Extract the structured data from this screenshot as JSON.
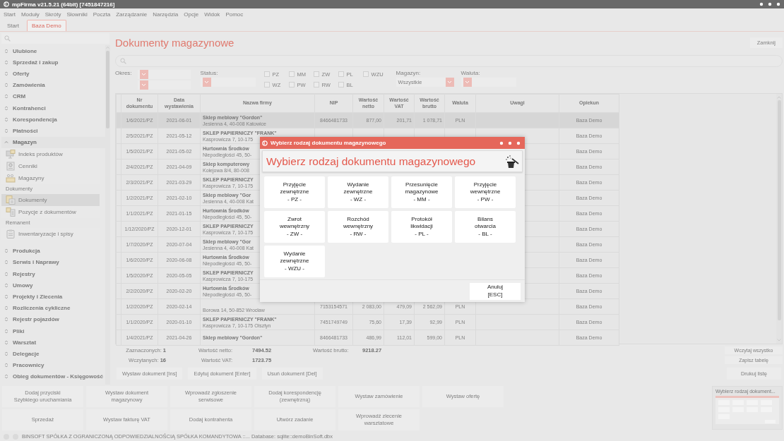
{
  "window": {
    "title": "mpFirma v21.5.21 (64bit) [7451847216]"
  },
  "menu": [
    "Start",
    "Moduły",
    "Skróty",
    "Słowniki",
    "Poczta",
    "Zarządzanie",
    "Narzędzia",
    "Opcje",
    "Widok",
    "Pomoc"
  ],
  "tabs": [
    {
      "label": "Start",
      "selected": false
    },
    {
      "label": "Baza Demo",
      "selected": true
    }
  ],
  "sidebar": {
    "sections": [
      {
        "label": "Ulubione",
        "expanded": false
      },
      {
        "label": "Sprzedaż i zakup",
        "expanded": false
      },
      {
        "label": "Oferty",
        "expanded": false
      },
      {
        "label": "Zamówienia",
        "expanded": false
      },
      {
        "label": "CRM",
        "expanded": false
      },
      {
        "label": "Kontrahenci",
        "expanded": false
      },
      {
        "label": "Korespondencja",
        "expanded": false
      },
      {
        "label": "Płatności",
        "expanded": false
      },
      {
        "label": "Magazyn",
        "expanded": true,
        "children": [
          {
            "kind": "item",
            "label": "Indeks produktów",
            "selected": false
          },
          {
            "kind": "item",
            "label": "Cenniki",
            "selected": false
          },
          {
            "kind": "item",
            "label": "Magazyny",
            "selected": false
          },
          {
            "kind": "group",
            "label": "Dokumenty"
          },
          {
            "kind": "item",
            "label": "Dokumenty",
            "selected": true
          },
          {
            "kind": "item",
            "label": "Pozycje z dokumentów",
            "selected": false
          },
          {
            "kind": "group",
            "label": "Remanent"
          },
          {
            "kind": "item",
            "label": "Inwentaryzacje i spisy",
            "selected": false
          }
        ]
      },
      {
        "label": "Produkcja",
        "expanded": false
      },
      {
        "label": "Serwis i Naprawy",
        "expanded": false
      },
      {
        "label": "Rejestry",
        "expanded": false
      },
      {
        "label": "Umowy",
        "expanded": false
      },
      {
        "label": "Projekty i Zlecenia",
        "expanded": false
      },
      {
        "label": "Rozliczenia cykliczne",
        "expanded": false
      },
      {
        "label": "Rejestr pojazdów",
        "expanded": false
      },
      {
        "label": "Pliki",
        "expanded": false
      },
      {
        "label": "Warsztat",
        "expanded": false
      },
      {
        "label": "Delegacje",
        "expanded": false
      },
      {
        "label": "Pracownicy",
        "expanded": false
      },
      {
        "label": "Obieg dokumentów - Księgowość",
        "expanded": false
      }
    ]
  },
  "page": {
    "title": "Dokumenty magazynowe",
    "close_button": "Zamknij",
    "filters": {
      "period_label": "Okres:",
      "status_label": "Status:",
      "types": [
        {
          "label": "PZ",
          "checked": false
        },
        {
          "label": "MM",
          "checked": false
        },
        {
          "label": "ZW",
          "checked": false
        },
        {
          "label": "PL",
          "checked": false
        },
        {
          "label": "WZU",
          "checked": false
        },
        {
          "label": "WZ",
          "checked": false
        },
        {
          "label": "PW",
          "checked": false
        },
        {
          "label": "RW",
          "checked": false
        },
        {
          "label": "BL",
          "checked": false
        }
      ],
      "warehouse": {
        "label": "Magazyn:",
        "value": "Wszystkie"
      },
      "currency": {
        "label": "Waluta:"
      }
    },
    "table": {
      "columns": [
        "Nr dokumentu",
        "Data wystawienia",
        "Nazwa firmy",
        "NIP",
        "Wartość netto",
        "Wartość VAT",
        "Wartość brutto",
        "Waluta",
        "Uwagi",
        "Opiekun"
      ],
      "rows": [
        {
          "selected": true,
          "number": "1/6/2021/PZ",
          "date": "2021-06-01",
          "company": "Sklep meblowy \"Gordon\"",
          "address": "Jesienna 4, 40-008 Katowice",
          "nip": "8466481733",
          "net": "877,00",
          "vat": "201,71",
          "gross": "1 078,71",
          "currency": "PLN",
          "owner": "Baza Demo"
        },
        {
          "selected": false,
          "number": "2/5/2021/PZ",
          "date": "2021-05-12",
          "company": "SKLEP PAPIERNICZY \"FRANK\"",
          "address": "Kasprowicza 7, 10-175",
          "owner": "Baza Demo"
        },
        {
          "selected": false,
          "number": "1/5/2021/PZ",
          "date": "2021-05-02",
          "company": "Hurtownia Środków",
          "address": "Niepodległości 45, 50-",
          "owner": "Baza Demo"
        },
        {
          "selected": false,
          "number": "2/4/2021/PZ",
          "date": "2021-04-09",
          "company": "Sklep komputerowy",
          "address": "Kolejowa 8/4, 80-008",
          "owner": "Baza Demo"
        },
        {
          "selected": false,
          "number": "2/3/2021/PZ",
          "date": "2021-03-29",
          "company": "SKLEP PAPIERNICZY",
          "address": "Kasprowicza 7, 10-175",
          "owner": "Baza Demo"
        },
        {
          "selected": false,
          "number": "1/2/2021/PZ",
          "date": "2021-02-10",
          "company": "Sklep meblowy \"Gor",
          "address": "Jesienna 4, 40-008 Kat",
          "owner": "Baza Demo"
        },
        {
          "selected": false,
          "number": "1/1/2021/PZ",
          "date": "2021-01-15",
          "company": "Hurtownia Środków",
          "address": "Niepodległości 45, 50-",
          "owner": "Baza Demo"
        },
        {
          "selected": false,
          "number": "1/12/2020/PZ",
          "date": "2020-12-01",
          "company": "SKLEP PAPIERNICZY",
          "address": "Kasprowicza 7, 10-175",
          "owner": "Baza Demo"
        },
        {
          "selected": false,
          "number": "1/7/2020/PZ",
          "date": "2020-07-04",
          "company": "Sklep meblowy \"Gor",
          "address": "Jesienna 4, 40-008 Kat",
          "owner": "Baza Demo"
        },
        {
          "selected": false,
          "number": "1/6/2020/PZ",
          "date": "2020-06-08",
          "company": "Hurtownia Środków",
          "address": "Niepodległości 45, 50-",
          "owner": "Baza Demo"
        },
        {
          "selected": false,
          "number": "1/5/2020/PZ",
          "date": "2020-05-05",
          "company": "SKLEP PAPIERNICZY",
          "address": "Kasprowicza 7, 10-175",
          "owner": "Baza Demo"
        },
        {
          "selected": false,
          "number": "2/2/2020/PZ",
          "date": "2020-02-20",
          "company": "Hurtownia Środków",
          "address": "Niepodległości 45, 50-",
          "owner": "Baza Demo"
        },
        {
          "selected": false,
          "number": "1/2/2020/PZ",
          "date": "2020-02-14",
          "address": "Borowa 14, 50-852 Wrocław",
          "nip": "7153154571",
          "net": "2 083,00",
          "vat": "479,09",
          "gross": "2 562,09",
          "currency": "PLN",
          "owner": "Baza Demo"
        },
        {
          "selected": false,
          "number": "1/1/2020/PZ",
          "date": "2020-01-10",
          "company": "SKLEP PAPIERNICZY \"FRANK\"",
          "address": "Kasprowicza 7, 10-175 Olsztyn",
          "nip": "7451749749",
          "net": "75,60",
          "vat": "17,39",
          "gross": "92,99",
          "currency": "PLN",
          "owner": "Baza Demo"
        },
        {
          "selected": false,
          "number": "1/4/2021/PZ",
          "date": "2021-04-26",
          "company": "Sklep meblowy \"Gordon\"",
          "nip": "8466481733",
          "net": "486,99",
          "vat": "112,01",
          "gross": "599,00",
          "currency": "PLN",
          "owner": "Baza Demo"
        }
      ]
    },
    "summary": {
      "selected": "Zaznaczonych: **1**",
      "loaded": "Wczytanych: **16**",
      "net_label": "Wartość netto:",
      "net_value": "7494.52",
      "vat_label": "Wartość VAT:",
      "vat_value": "1723.75",
      "gross_label": "Wartość brutto:",
      "gross_value": "9218.27",
      "load_all_button": "Wczytaj wszystko",
      "save_table_button": "Zapisz tabelę"
    },
    "actions": [
      "Wystaw dokument [Ins]",
      "Edytuj dokument [Enter]",
      "Usuń dokument [Del]"
    ],
    "print_button": "Drukuj listę"
  },
  "quick_buttons": [
    {
      "lines": [
        "Dodaj przyciski",
        "Szybkiego uruchamiania"
      ]
    },
    {
      "lines": [
        "Wystaw dokument",
        "magazynowy"
      ]
    },
    {
      "lines": [
        "Wprowadź zgłoszenie",
        "serwisowe"
      ]
    },
    {
      "lines": [
        "Dodaj korespondencję",
        "(zewnętrzną)"
      ]
    },
    {
      "lines": [
        "Wystaw zamówienie"
      ]
    },
    {
      "lines": [
        "Wystaw ofertę"
      ]
    },
    {
      "lines": [
        "Sprzedaż"
      ]
    },
    {
      "lines": [
        "Wystaw fakturę VAT"
      ]
    },
    {
      "lines": [
        "Dodaj kontrahenta"
      ]
    },
    {
      "lines": [
        "Utwórz zadanie"
      ]
    },
    {
      "lines": [
        "Wprowadź zlecenie",
        "warsztatowe"
      ]
    }
  ],
  "window_preview": {
    "title": "Wybierz rodzaj dokument..."
  },
  "status_bar": {
    "text": "BINSOFT SPÓŁKA Z OGRANICZONĄ ODPOWIEDZIALNOŚCIĄ SPÓŁKA KOMANDYTOWA ::... Database: sqlite::demoBinSoft.dbx"
  },
  "dialog": {
    "title": "Wybierz rodzaj dokumentu magazynowego",
    "heading": "Wybierz rodzaj dokumentu magazynowego",
    "options": [
      {
        "lines": [
          "Przyjęcie",
          "zewnętrzne",
          "- PZ -"
        ]
      },
      {
        "lines": [
          "Wydanie",
          "zewnętrzne",
          "- WZ -"
        ]
      },
      {
        "lines": [
          "Przesunięcie",
          "magazynowe",
          "- MM -"
        ]
      },
      {
        "lines": [
          "Przyjęcie",
          "wewnętrzne",
          "- PW -"
        ]
      },
      {
        "lines": [
          "Zwrot",
          "wewnętrzny",
          "- ZW -"
        ]
      },
      {
        "lines": [
          "Rozchód",
          "wewnętrzny",
          "- RW -"
        ]
      },
      {
        "lines": [
          "Protokół",
          "likwidacji",
          "- PL -"
        ]
      },
      {
        "lines": [
          "Bilans",
          "otwarcia",
          "- BL -"
        ]
      },
      {
        "lines": [
          "Wydanie",
          "zewnętrzne",
          "- WZU -"
        ]
      }
    ],
    "cancel": {
      "lines": [
        "Anuluj",
        "[ESC]"
      ]
    }
  }
}
